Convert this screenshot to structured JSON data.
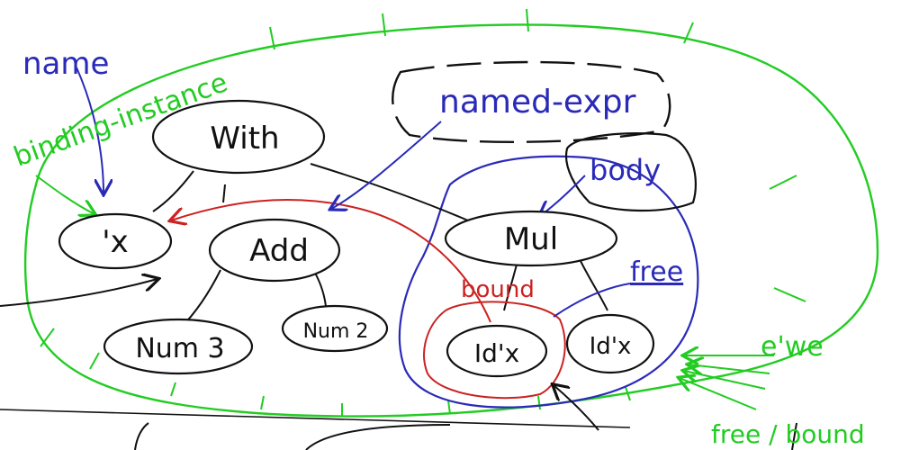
{
  "labels": {
    "name": "name",
    "binding_instance": "binding-instance",
    "named_expr": "named-expr",
    "body": "body",
    "bound": "bound",
    "free": "free",
    "ewe": "e'we",
    "free_bound": "free / bound"
  },
  "nodes": {
    "with": "With",
    "x": "'x",
    "add": "Add",
    "num3": "Num 3",
    "num2": "Num 2",
    "mul": "Mul",
    "id_x_bound": "Id'x",
    "id_x_free": "Id'x"
  },
  "colors": {
    "ink": "#111111",
    "green": "#22cc22",
    "blue": "#2a2ab8",
    "red": "#cc2222"
  }
}
